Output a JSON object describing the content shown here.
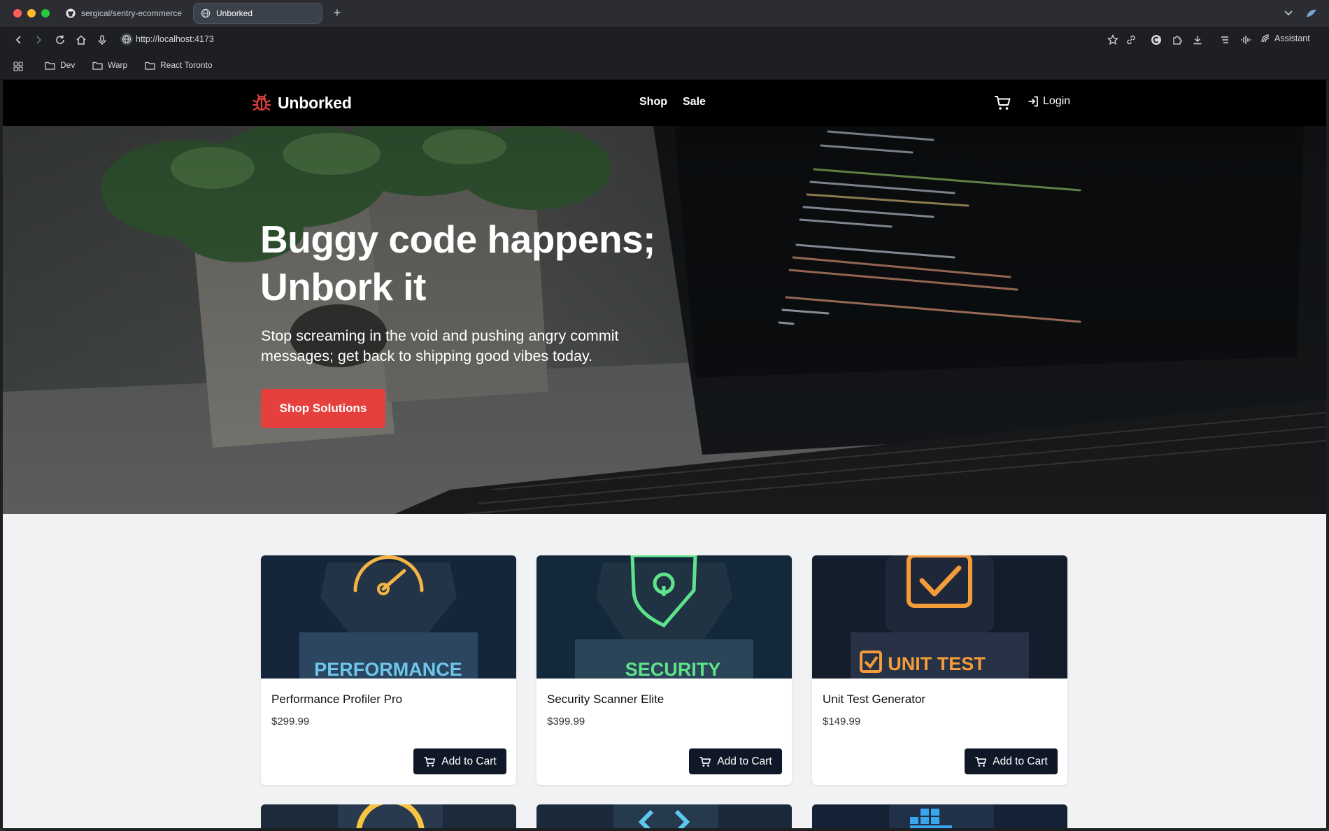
{
  "browser": {
    "tabs": [
      {
        "title": "sergical/sentry-ecommerce",
        "icon": "github-icon",
        "active": false
      },
      {
        "title": "Unborked",
        "icon": "globe-icon",
        "active": true
      }
    ],
    "url": "http://localhost:4173",
    "assistant_label": "Assistant",
    "bookmarks": [
      {
        "label": "Dev",
        "icon": "folder-icon"
      },
      {
        "label": "Warp",
        "icon": "folder-icon"
      },
      {
        "label": "React Toronto",
        "icon": "folder-icon"
      }
    ]
  },
  "site": {
    "brand": "Unborked",
    "brand_icon": "bug-icon",
    "brand_color": "#e5403e",
    "nav": [
      "Shop",
      "Sale"
    ],
    "login_label": "Login"
  },
  "hero": {
    "title": "Buggy code happens; Unbork it",
    "subtitle": "Stop screaming in the void and pushing angry commit messages; get back to shipping good vibes today.",
    "cta": "Shop Solutions",
    "cta_color": "#e5403e"
  },
  "products": [
    {
      "name": "Performance Profiler Pro",
      "price": "$299.99",
      "add_label": "Add to Cart",
      "image_text": "PERFORMANCE",
      "image_icon": "speedometer-icon"
    },
    {
      "name": "Security Scanner Elite",
      "price": "$399.99",
      "add_label": "Add to Cart",
      "image_text": "SECURITY",
      "image_icon": "shield-lock-icon"
    },
    {
      "name": "Unit Test Generator",
      "price": "$149.99",
      "add_label": "Add to Cart",
      "image_text": "UNIT TEST",
      "image_icon": "checkbox-icon"
    }
  ],
  "colors": {
    "header_bg": "#000000",
    "button_dark": "#101726",
    "page_bg": "#f1f2f4"
  }
}
